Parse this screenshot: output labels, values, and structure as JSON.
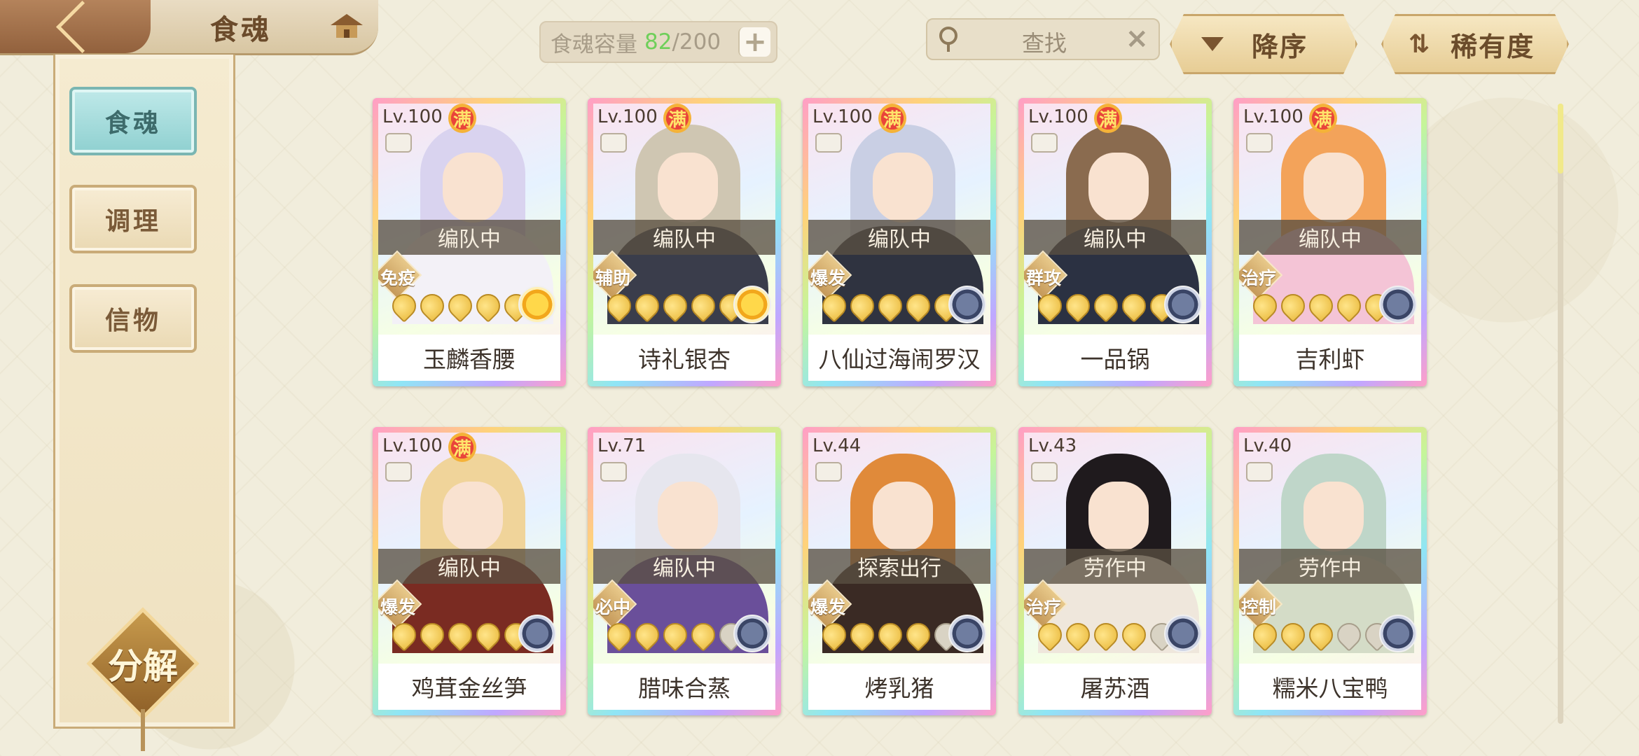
{
  "header": {
    "title": "食魂",
    "back_icon": "back-arrow-icon",
    "home_icon": "house-icon"
  },
  "sidebar": {
    "tabs": [
      {
        "label": "食魂",
        "active": true
      },
      {
        "label": "调理",
        "active": false
      },
      {
        "label": "信物",
        "active": false
      }
    ],
    "decompose_label": "分解"
  },
  "capacity": {
    "label": "食魂容量",
    "current": "82",
    "max": "/200",
    "add_icon": "plus-icon"
  },
  "search": {
    "placeholder": "查找",
    "icon": "magnifier-icon",
    "clear_icon": "close-icon"
  },
  "sort": {
    "order_label": "降序",
    "rarity_label": "稀有度"
  },
  "colors": {
    "accent_teal": "#8fd0d0",
    "capacity_green": "#6fcf5a",
    "status_bg": "#5a5041"
  },
  "cards": [
    {
      "level": "Lv.100",
      "max": true,
      "status": "编队中",
      "role": "免疫",
      "stars": 5,
      "stars_total": 5,
      "element": "gold",
      "name": "玉麟香腰",
      "hair": "#d9d3ef",
      "outfit": "#f3f1f7"
    },
    {
      "level": "Lv.100",
      "max": true,
      "status": "编队中",
      "role": "辅助",
      "stars": 5,
      "stars_total": 5,
      "element": "gold",
      "name": "诗礼银杏",
      "hair": "#cfc6b2",
      "outfit": "#3a3d4b"
    },
    {
      "level": "Lv.100",
      "max": true,
      "status": "编队中",
      "role": "爆发",
      "stars": 5,
      "stars_total": 5,
      "element": "blue",
      "name": "八仙过海闹罗汉",
      "hair": "#c9cfe4",
      "outfit": "#2f3340"
    },
    {
      "level": "Lv.100",
      "max": true,
      "status": "编队中",
      "role": "群攻",
      "stars": 5,
      "stars_total": 5,
      "element": "blue",
      "name": "一品锅",
      "hair": "#8a6b4f",
      "outfit": "#2b3142"
    },
    {
      "level": "Lv.100",
      "max": true,
      "status": "编队中",
      "role": "治疗",
      "stars": 5,
      "stars_total": 5,
      "element": "blue",
      "name": "吉利虾",
      "hair": "#f3a35a",
      "outfit": "#f4c4d6"
    },
    {
      "level": "Lv.100",
      "max": true,
      "status": "编队中",
      "role": "爆发",
      "stars": 5,
      "stars_total": 5,
      "element": "blue",
      "name": "鸡茸金丝笋",
      "hair": "#f0d49a",
      "outfit": "#7a2b22"
    },
    {
      "level": "Lv.71",
      "max": false,
      "status": "编队中",
      "role": "必中",
      "stars": 4,
      "stars_total": 5,
      "element": "blue",
      "name": "腊味合蒸",
      "hair": "#e6e6ee",
      "outfit": "#6a4f9a"
    },
    {
      "level": "Lv.44",
      "max": false,
      "status": "探索出行",
      "role": "爆发",
      "stars": 4,
      "stars_total": 5,
      "element": "blue",
      "name": "烤乳猪",
      "hair": "#e08a3a",
      "outfit": "#3a2a24"
    },
    {
      "level": "Lv.43",
      "max": false,
      "status": "劳作中",
      "role": "治疗",
      "stars": 4,
      "stars_total": 5,
      "element": "blue",
      "name": "屠苏酒",
      "hair": "#1f1a1d",
      "outfit": "#efe7dc"
    },
    {
      "level": "Lv.40",
      "max": false,
      "status": "劳作中",
      "role": "控制",
      "stars": 3,
      "stars_total": 5,
      "element": "blue",
      "name": "糯米八宝鸭",
      "hair": "#bfd6c9",
      "outfit": "#d4dcc7"
    }
  ],
  "card_badge_max": "满"
}
